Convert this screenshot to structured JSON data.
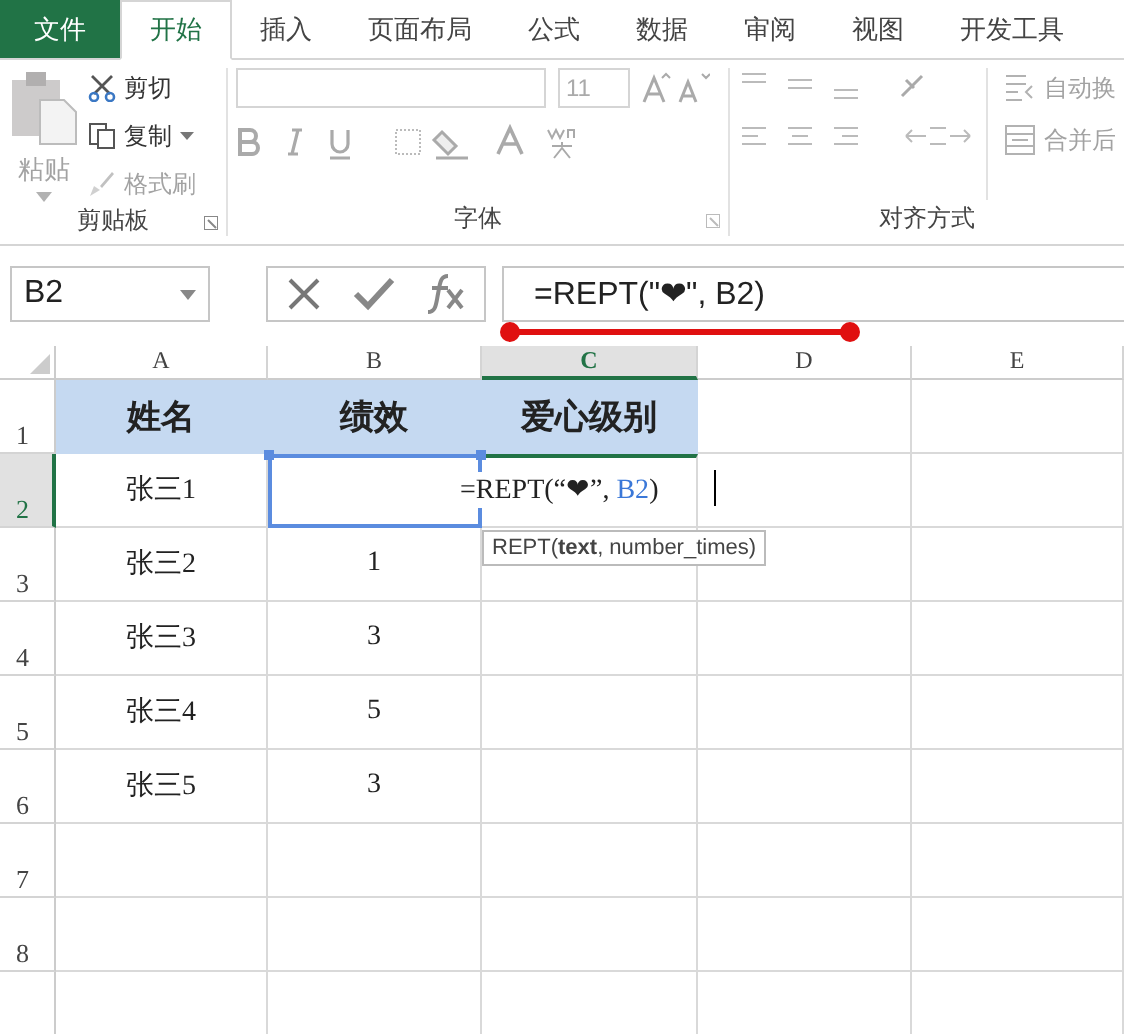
{
  "tabs": [
    {
      "label": "文件",
      "kind": "file",
      "selected": false
    },
    {
      "label": "开始",
      "kind": "tab",
      "selected": true
    },
    {
      "label": "插入",
      "kind": "tab",
      "selected": false
    },
    {
      "label": "页面布局",
      "kind": "tab",
      "selected": false
    },
    {
      "label": "公式",
      "kind": "tab",
      "selected": false
    },
    {
      "label": "数据",
      "kind": "tab",
      "selected": false
    },
    {
      "label": "审阅",
      "kind": "tab",
      "selected": false
    },
    {
      "label": "视图",
      "kind": "tab",
      "selected": false
    },
    {
      "label": "开发工具",
      "kind": "tab",
      "selected": false
    }
  ],
  "ribbon": {
    "disabled": true,
    "clipboard": {
      "title": "剪贴板",
      "paste": "粘贴",
      "cut": "剪切",
      "copy": "复制",
      "format_painter": "格式刷"
    },
    "font": {
      "title": "字体",
      "size": "11"
    },
    "alignment": {
      "title": "对齐方式",
      "wrap": "自动换",
      "merge": "合并后"
    }
  },
  "formula_bar": {
    "name_box": "B2",
    "formula": "=REPT(\"❤\", B2)",
    "annotated": true
  },
  "columns": [
    {
      "label": "A",
      "selected": false
    },
    {
      "label": "B",
      "selected": false
    },
    {
      "label": "C",
      "selected": true
    },
    {
      "label": "D",
      "selected": false
    },
    {
      "label": "E",
      "selected": false
    }
  ],
  "rows": [
    {
      "number": "1",
      "selected": false,
      "kind": "header",
      "a": "姓名",
      "b": "绩效",
      "c": "爱心级别"
    },
    {
      "number": "2",
      "selected": true,
      "kind": "editing",
      "a": "张三1",
      "edit": {
        "text": "=REPT(“❤”, ",
        "reference": "B2",
        "closing": ")"
      }
    },
    {
      "number": "3",
      "selected": false,
      "kind": "data",
      "a": "张三2",
      "b": "1"
    },
    {
      "number": "4",
      "selected": false,
      "kind": "data",
      "a": "张三3",
      "b": "3"
    },
    {
      "number": "5",
      "selected": false,
      "kind": "data",
      "a": "张三4",
      "b": "5"
    },
    {
      "number": "6",
      "selected": false,
      "kind": "data",
      "a": "张三5",
      "b": "3"
    },
    {
      "number": "7",
      "selected": false,
      "kind": "data"
    },
    {
      "number": "8",
      "selected": false,
      "kind": "data"
    },
    {
      "selected": false,
      "kind": "data"
    }
  ],
  "tooltip": {
    "name": "REPT(",
    "argument": "text",
    "rest": ", number_times)"
  }
}
